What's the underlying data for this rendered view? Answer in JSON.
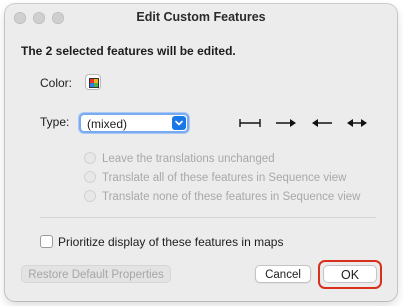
{
  "window": {
    "title": "Edit Custom Features"
  },
  "heading": "The 2 selected features will be edited.",
  "color": {
    "label": "Color:",
    "icon": "color-palette-icon",
    "swatch_colors": [
      "#e8312a",
      "#f2b01e",
      "#2f7de1",
      "#4bb04f"
    ]
  },
  "type": {
    "label": "Type:",
    "selected": "(mixed)",
    "icons": [
      "interval-icon",
      "arrow-right-icon",
      "arrow-left-icon",
      "arrow-both-icon"
    ]
  },
  "translation_options": [
    {
      "label": "Leave the translations unchanged"
    },
    {
      "label": "Translate all of these features in Sequence view"
    },
    {
      "label": "Translate none of these features in Sequence view"
    }
  ],
  "prioritize": {
    "label": "Prioritize display of these features in maps",
    "checked": false
  },
  "buttons": {
    "restore": "Restore Default Properties",
    "cancel": "Cancel",
    "ok": "OK"
  },
  "colors": {
    "accent": "#1a78e6",
    "highlight": "#d9301e"
  }
}
